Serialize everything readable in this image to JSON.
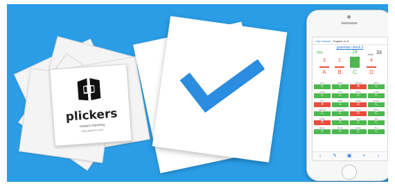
{
  "colors": {
    "banner_bg": "#2a9de6",
    "correct": "#4cb84f",
    "incorrect": "#e74c3c",
    "accent": "#2a7ad8"
  },
  "brand": {
    "name": "plickers",
    "tagline": "Instant checking",
    "fine_print": "www.plickers.com"
  },
  "phone": {
    "nav_back": "My Classes",
    "nav_title": "English 11-A",
    "question_title": "grammar check 3",
    "percent_correct": "79%",
    "total_label": "total",
    "total_value": "33",
    "answers": [
      {
        "letter": "A",
        "count": "3",
        "correct": false
      },
      {
        "letter": "B",
        "count": "2",
        "correct": false
      },
      {
        "letter": "C",
        "count": "24",
        "correct": true
      },
      {
        "letter": "D",
        "count": "4",
        "correct": false
      }
    ],
    "students": [
      {
        "name": "Erin",
        "answer": "C",
        "correct": true
      },
      {
        "name": "Yasuo",
        "answer": "C",
        "correct": true
      },
      {
        "name": "Gerardo",
        "answer": "A",
        "correct": false
      },
      {
        "name": "Harry",
        "answer": "C",
        "correct": true
      },
      {
        "name": "Ingrid",
        "answer": "C",
        "correct": true
      },
      {
        "name": "Jandi",
        "answer": "C",
        "correct": true
      },
      {
        "name": "Klaus",
        "answer": "C",
        "correct": true
      },
      {
        "name": "Lucia",
        "answer": "C",
        "correct": true
      },
      {
        "name": "Kim",
        "answer": "A",
        "correct": false
      },
      {
        "name": "Malik",
        "answer": "C",
        "correct": true
      },
      {
        "name": "Nadia",
        "answer": "D",
        "correct": false
      },
      {
        "name": "Oscar",
        "answer": "C",
        "correct": true
      },
      {
        "name": "Manuel",
        "answer": "C",
        "correct": true
      },
      {
        "name": "Natasha",
        "answer": "C",
        "correct": true
      },
      {
        "name": "Omar",
        "answer": "D",
        "correct": false
      },
      {
        "name": "Peter",
        "answer": "C",
        "correct": true
      },
      {
        "name": "Paula",
        "answer": "B",
        "correct": false
      },
      {
        "name": "Raj",
        "answer": "C",
        "correct": true
      },
      {
        "name": "Sara",
        "answer": "C",
        "correct": true
      },
      {
        "name": "Tom",
        "answer": "C",
        "correct": true
      },
      {
        "name": "Quinn",
        "answer": "C",
        "correct": true
      },
      {
        "name": "Rosie",
        "answer": "C",
        "correct": true
      },
      {
        "name": "Susie",
        "answer": "C",
        "correct": true
      },
      {
        "name": "Teo",
        "answer": "C",
        "correct": true
      }
    ],
    "tabs": [
      "chevron-left-icon",
      "pencil-icon",
      "camera-icon",
      "plus-icon",
      "chevron-right-icon"
    ]
  }
}
